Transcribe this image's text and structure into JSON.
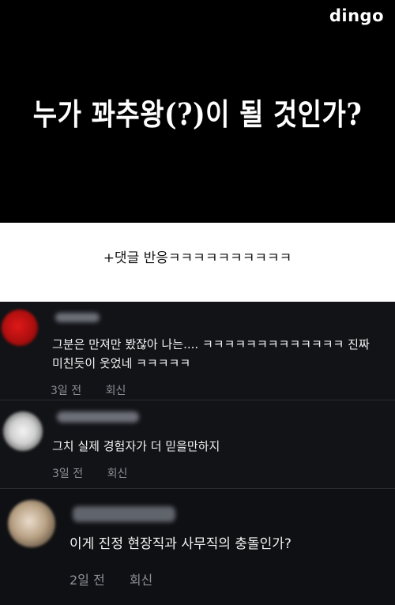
{
  "logo": "dingo",
  "headline": "누가 꽈추왕(?)이 될 것인가?",
  "caption": "+댓글 반응ㅋㅋㅋㅋㅋㅋㅋㅋㅋㅋ",
  "comments": [
    {
      "text": "그분은 만져만 봤잖아 나는.... ㅋㅋㅋㅋㅋㅋㅋㅋㅋㅋㅋㅋㅋ 진짜 미친듯이 웃었네 ㅋㅋㅋㅋㅋ",
      "time": "3일 전",
      "reply": "회신"
    },
    {
      "text": "그치 실제 경험자가 더 믿을만하지",
      "time": "3일 전",
      "reply": "회신"
    },
    {
      "text": "이게 진정 현장직과 사무직의 충돌인가?",
      "time": "2일 전",
      "reply": "회신"
    }
  ]
}
